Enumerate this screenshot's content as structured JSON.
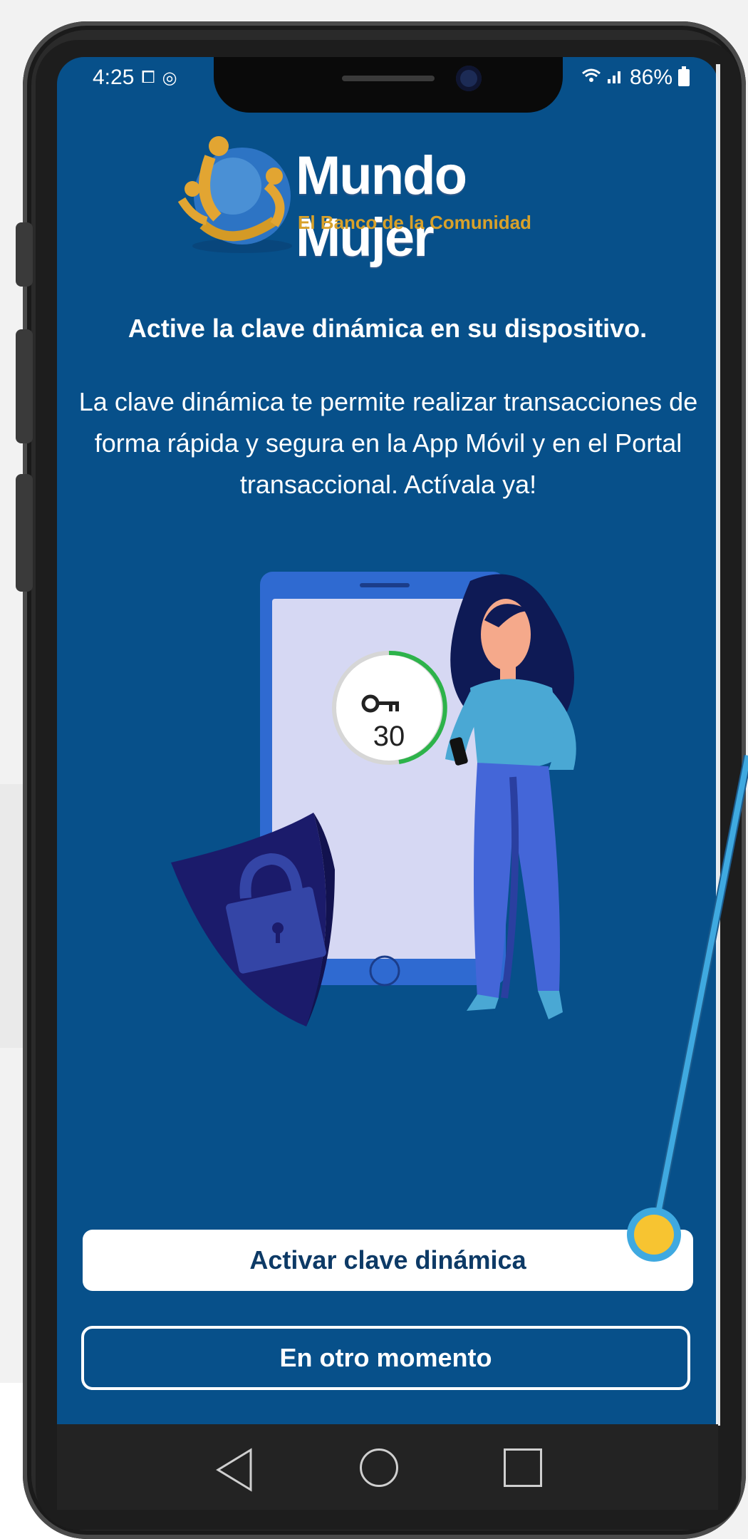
{
  "status_bar": {
    "time": "4:25",
    "left_icons": [
      "screen-record-icon",
      "instagram-icon"
    ],
    "battery": "86%"
  },
  "logo": {
    "name": "Mundo Mujer",
    "tagline": "El Banco de la Comunidad"
  },
  "main": {
    "title": "Active la clave dinámica en su dispositivo.",
    "description": "La clave dinámica te permite realizar transacciones de forma rápida y segura en la App Móvil y en el Portal transaccional. Actívala ya!",
    "timer_value": "30"
  },
  "buttons": {
    "activate_label": "Activar clave dinámica",
    "later_label": "En otro momento"
  },
  "colors": {
    "screen_bg": "#07508a",
    "callout_line": "#3fa9e0",
    "callout_dot": "#f7c431"
  }
}
